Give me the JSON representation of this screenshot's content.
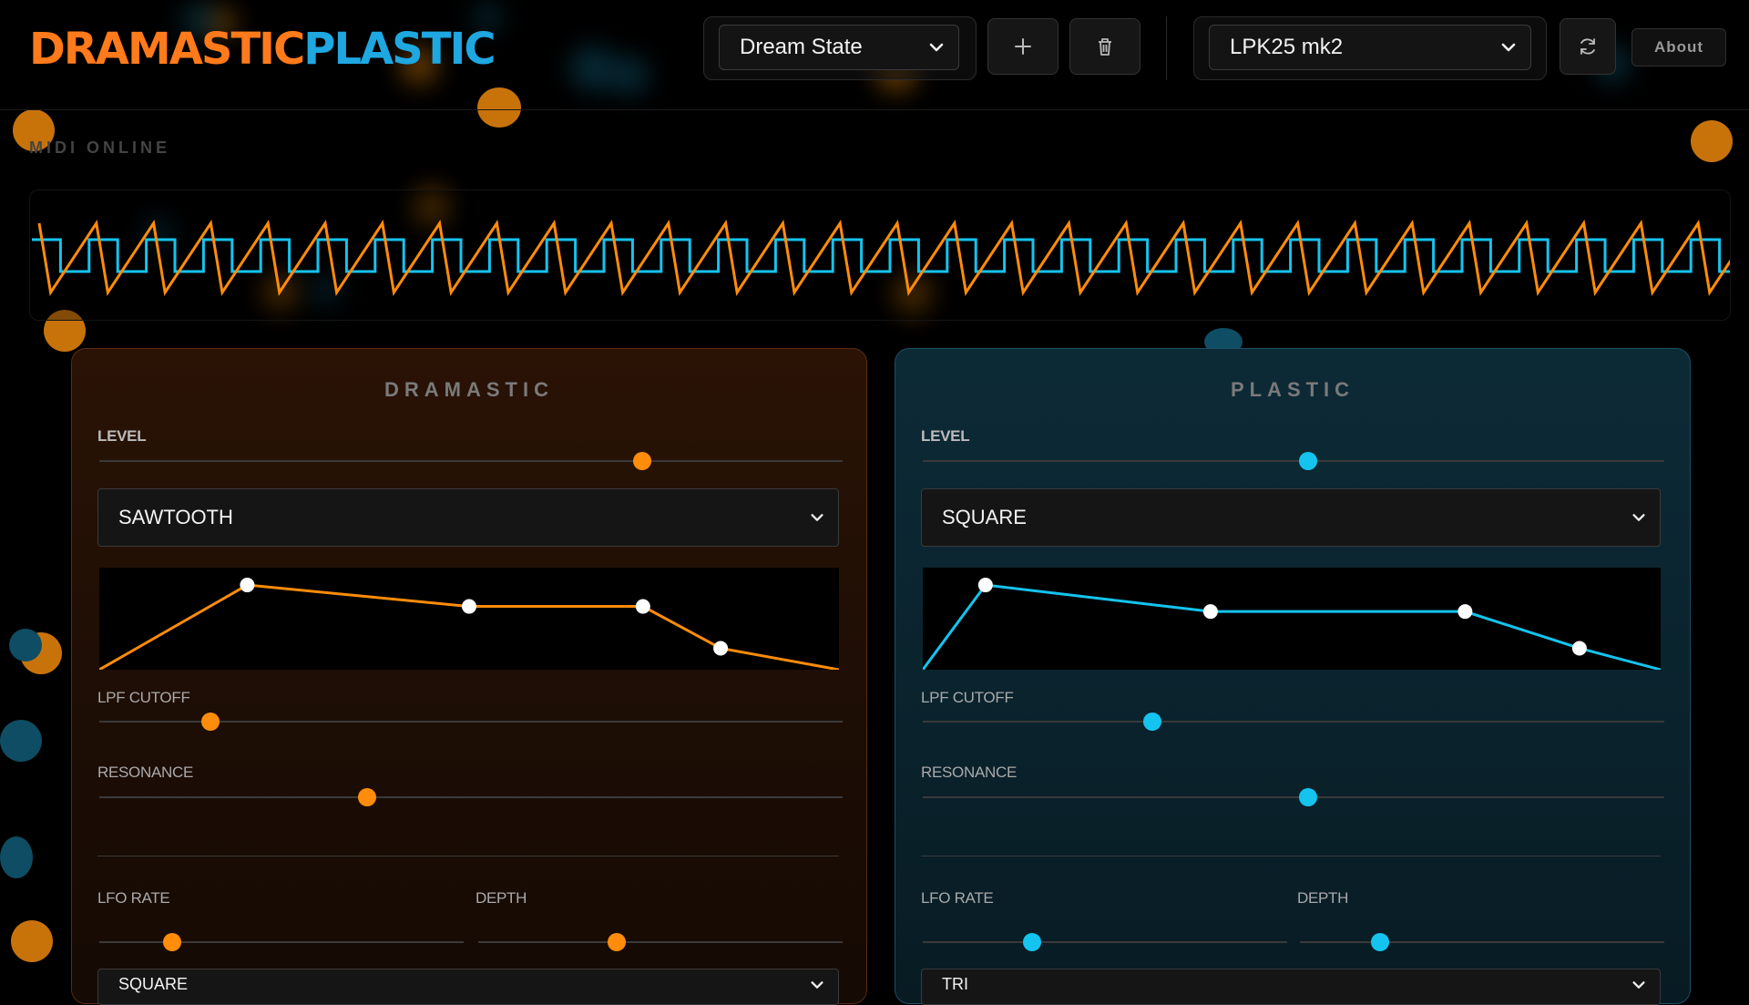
{
  "app": {
    "logo_part1": "DRAMASTIC",
    "logo_part2": "PLASTIC"
  },
  "header": {
    "preset_value": "Dream State",
    "midi_device_value": "LPK25 mk2",
    "about_label": "About",
    "icons": {
      "add": "plus-icon",
      "delete": "trash-icon",
      "refresh": "refresh-icon",
      "dropdown": "chevron-down-icon"
    }
  },
  "status": {
    "text": "MIDI ONLINE"
  },
  "colors": {
    "dramastic": "#ff8c0a",
    "plastic": "#14c4ef"
  },
  "dramastic": {
    "title": "DRAMASTIC",
    "level_label": "LEVEL",
    "level": 0.73,
    "waveform": "SAWTOOTH",
    "envelope": [
      [
        0,
        1.0
      ],
      [
        0.2,
        0.17
      ],
      [
        0.5,
        0.38
      ],
      [
        0.735,
        0.38
      ],
      [
        0.84,
        0.79
      ],
      [
        1,
        1.0
      ]
    ],
    "cutoff_label": "LPF CUTOFF",
    "cutoff": 0.15,
    "resonance_label": "RESONANCE",
    "resonance": 0.36,
    "lfo_rate_label": "LFO RATE",
    "lfo_rate": 0.2,
    "depth_label": "DEPTH",
    "depth": 0.38,
    "lfo_waveform": "SQUARE"
  },
  "plastic": {
    "title": "PLASTIC",
    "level_label": "LEVEL",
    "level": 0.52,
    "waveform": "SQUARE",
    "envelope": [
      [
        0,
        1.0
      ],
      [
        0.085,
        0.17
      ],
      [
        0.39,
        0.43
      ],
      [
        0.735,
        0.43
      ],
      [
        0.89,
        0.79
      ],
      [
        1,
        1.0
      ]
    ],
    "cutoff_label": "LPF CUTOFF",
    "cutoff": 0.31,
    "resonance_label": "RESONANCE",
    "resonance": 0.52,
    "lfo_rate_label": "LFO RATE",
    "lfo_rate": 0.3,
    "depth_label": "DEPTH",
    "depth": 0.22,
    "lfo_waveform": "TRI"
  }
}
